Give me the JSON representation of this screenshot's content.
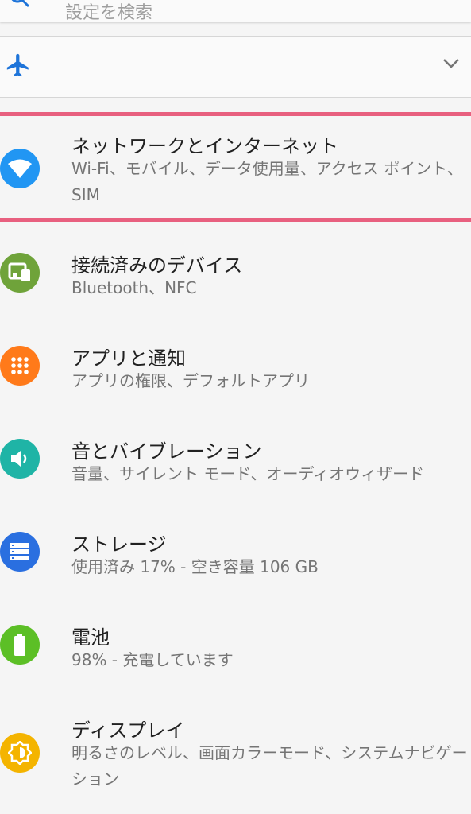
{
  "search": {
    "placeholder": "設定を検索"
  },
  "airplane": {
    "icon": "airplane-icon",
    "expand_icon": "chevron-down-icon"
  },
  "items": [
    {
      "title": "ネットワークとインターネット",
      "subtitle": "Wi-Fi、モバイル、データ使用量、アクセス ポイント、SIM",
      "icon": "wifi-icon",
      "color": "#2196f3",
      "highlighted": true
    },
    {
      "title": "接続済みのデバイス",
      "subtitle": "Bluetooth、NFC",
      "icon": "devices-icon",
      "color": "#6fa33a"
    },
    {
      "title": "アプリと通知",
      "subtitle": "アプリの権限、デフォルトアプリ",
      "icon": "apps-icon",
      "color": "#ff7a1a"
    },
    {
      "title": "音とバイブレーション",
      "subtitle": "音量、サイレント モード、オーディオウィザード",
      "icon": "volume-icon",
      "color": "#1fb4a6"
    },
    {
      "title": "ストレージ",
      "subtitle": "使用済み 17% - 空き容量 106 GB",
      "icon": "storage-icon",
      "color": "#2a6fe0"
    },
    {
      "title": "電池",
      "subtitle": "98% - 充電しています",
      "icon": "battery-icon",
      "color": "#5cbf26"
    },
    {
      "title": "ディスプレイ",
      "subtitle": "明るさのレベル、画面カラーモード、システムナビゲーション",
      "icon": "display-icon",
      "color": "#f4b400"
    }
  ],
  "colors": {
    "highlight_border": "#e8607f",
    "plane_blue": "#1e74d9"
  }
}
